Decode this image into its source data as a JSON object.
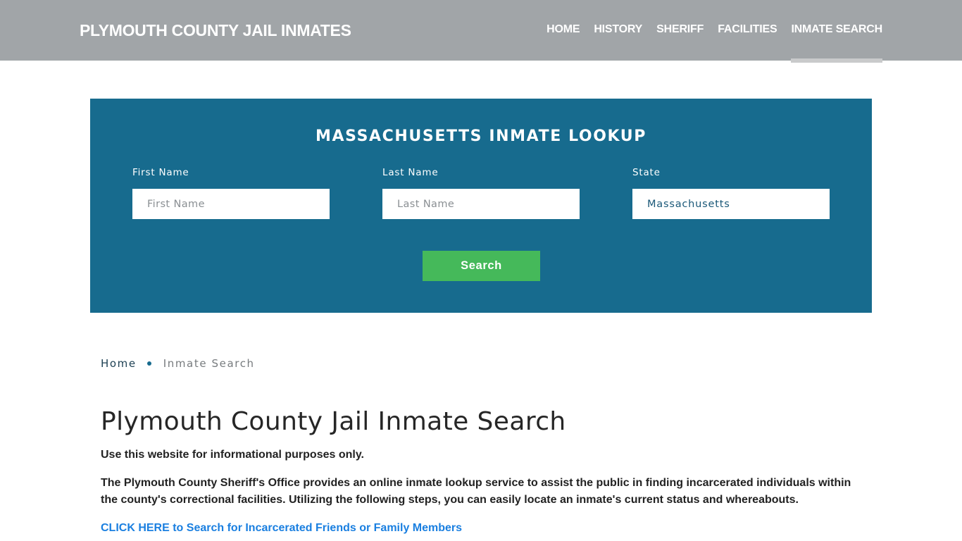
{
  "header": {
    "site_title": "PLYMOUTH COUNTY JAIL INMATES",
    "nav": [
      {
        "label": "HOME",
        "active": false
      },
      {
        "label": "HISTORY",
        "active": false
      },
      {
        "label": "SHERIFF",
        "active": false
      },
      {
        "label": "FACILITIES",
        "active": false
      },
      {
        "label": "INMATE SEARCH",
        "active": true
      }
    ]
  },
  "lookup": {
    "title": "MASSACHUSETTS INMATE LOOKUP",
    "fields": {
      "first_name": {
        "label": "First Name",
        "placeholder": "First Name",
        "value": ""
      },
      "last_name": {
        "label": "Last Name",
        "placeholder": "Last Name",
        "value": ""
      },
      "state": {
        "label": "State",
        "value": "Massachusetts"
      }
    },
    "search_label": "Search"
  },
  "breadcrumb": {
    "home": "Home",
    "current": "Inmate Search"
  },
  "content": {
    "title": "Plymouth County Jail Inmate Search",
    "paragraph1": "Use this website for informational purposes only.",
    "paragraph2": "The Plymouth County Sheriff's Office provides an online inmate lookup service to assist the public in finding incarcerated individuals within the county's correctional facilities. Utilizing the following steps, you can easily locate an inmate's current status and whereabouts.",
    "cta_link": "CLICK HERE to Search for Incarcerated Friends or Family Members"
  },
  "colors": {
    "header_bg": "#a1a5a8",
    "lookup_bg": "#176b8e",
    "search_button": "#45b95a",
    "link": "#1a7fe0"
  }
}
